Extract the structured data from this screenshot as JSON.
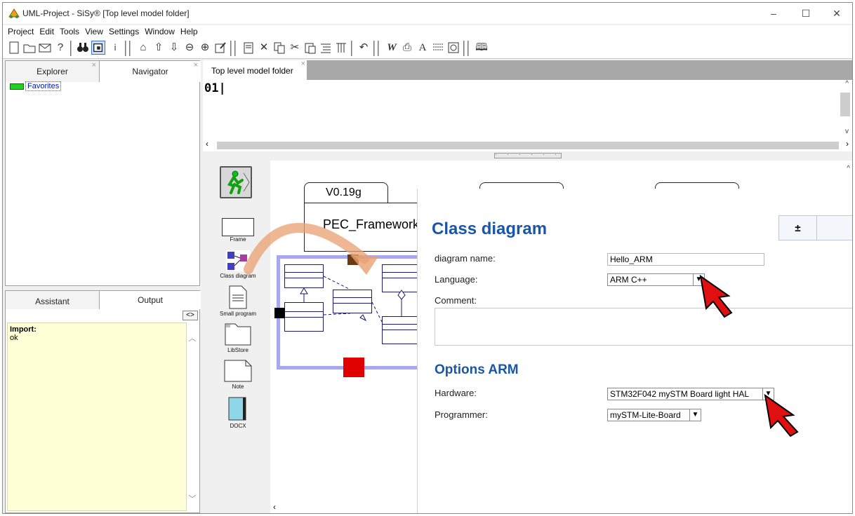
{
  "window": {
    "title": "UML-Project - SiSy® [Top level model folder]",
    "minimize": "–",
    "maximize": "☐",
    "close": "✕"
  },
  "menu": [
    "Project",
    "Edit",
    "Tools",
    "View",
    "Settings",
    "Window",
    "Help"
  ],
  "left_top": {
    "tabs": [
      "Explorer",
      "Navigator"
    ],
    "tree_item": "Favorites",
    "tab_close": "×"
  },
  "left_bottom": {
    "tabs": [
      "Assistant",
      "Output"
    ],
    "nav_button": "<>",
    "output_title": "Import:",
    "output_text": "ok"
  },
  "editor": {
    "tab_label": "Top level model folder",
    "code": "01|"
  },
  "palette": {
    "items": [
      "Frame",
      "Class diagram",
      "Small program",
      "LibStore",
      "Note",
      "DOCX"
    ]
  },
  "canvas": {
    "package_tab": "V0.19g",
    "package_name": "PEC_Framework"
  },
  "dialog": {
    "title": "Class diagram",
    "pm_button": "±",
    "fields": {
      "name_label": "diagram name:",
      "name_value": "Hello_ARM",
      "language_label": "Language:",
      "language_value": "ARM C++",
      "comment_label": "Comment:"
    },
    "options_title": "Options ARM",
    "options": {
      "hardware_label": "Hardware:",
      "hardware_value": "STM32F042 mySTM Board light HAL",
      "programmer_label": "Programmer:",
      "programmer_value": "mySTM-Lite-Board"
    }
  },
  "colors": {
    "accent": "#1a56a8",
    "favorites_green": "#22d022",
    "output_bg": "#ffffd8",
    "selection": "#a8a8f0",
    "handle_red": "#e00000",
    "handle_brown": "#6b3a10"
  },
  "icons": [
    "new-icon",
    "open-icon",
    "mail-icon",
    "help-icon",
    "search-icon",
    "window-icon",
    "info-icon",
    "home-icon",
    "up-icon",
    "down-icon",
    "zoom-out-icon",
    "zoom-in-icon",
    "edit-icon",
    "properties-icon",
    "cut-icon",
    "copy-icon",
    "cut-icon",
    "paste-icon",
    "list-icon",
    "grid-icon",
    "undo-icon",
    "word-icon",
    "print-icon",
    "font-icon",
    "align-icon",
    "refresh-icon",
    "book-icon"
  ]
}
